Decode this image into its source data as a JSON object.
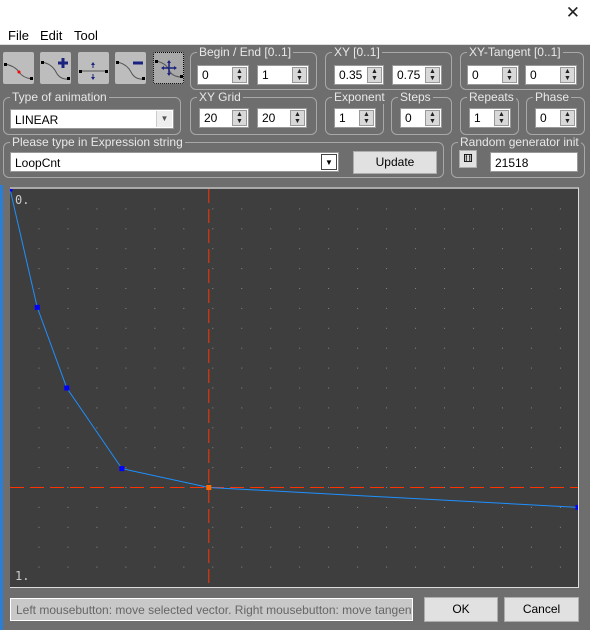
{
  "window": {
    "close_icon": "close-icon"
  },
  "menu": [
    "File",
    "Edit",
    "Tool"
  ],
  "toolbar": {
    "tools": [
      "curve-add-point-icon",
      "curve-add-icon",
      "split-icon",
      "curve-remove-icon",
      "move-vector-icon"
    ],
    "selected_index": 4
  },
  "begin_end": {
    "label": "Begin / End [0..1]",
    "begin": "0",
    "end": "1"
  },
  "xy": {
    "label": "XY [0..1]",
    "x": "0.35",
    "y": "0.75"
  },
  "xy_tangent": {
    "label": "XY-Tangent [0..1]",
    "x": "0",
    "y": "0"
  },
  "animation": {
    "label": "Type of animation",
    "value": "LINEAR"
  },
  "xy_grid": {
    "label": "XY Grid",
    "x": "20",
    "y": "20"
  },
  "exponent": {
    "label": "Exponent",
    "value": "1"
  },
  "steps": {
    "label": "Steps",
    "value": "0"
  },
  "repeats": {
    "label": "Repeats",
    "value": "1"
  },
  "phase": {
    "label": "Phase",
    "value": "0"
  },
  "expression": {
    "label": "Please type in Expression string",
    "value": "LoopCnt",
    "update_label": "Update"
  },
  "random": {
    "label": "Random generator init",
    "value": "21518"
  },
  "plot": {
    "top_label": "0.",
    "bottom_label": "1.",
    "line_color": "#1e90ff",
    "point_color": "#0000ff",
    "selected_color": "#ff6a00",
    "crosshair_color": "#ff3300"
  },
  "chart_data": {
    "type": "line",
    "x": [
      0,
      0.048,
      0.1,
      0.197,
      0.35,
      1
    ],
    "y": [
      0,
      0.2975,
      0.5,
      0.7025,
      0.75,
      0.8
    ],
    "selected_index": 4,
    "crosshair": [
      0.35,
      0.75
    ],
    "grid": true,
    "grid_divisions": 20
  },
  "status": "Left mousebutton: move selected vector. Right mousebutton: move tangent of selected vector",
  "buttons": {
    "ok": "OK",
    "cancel": "Cancel"
  }
}
